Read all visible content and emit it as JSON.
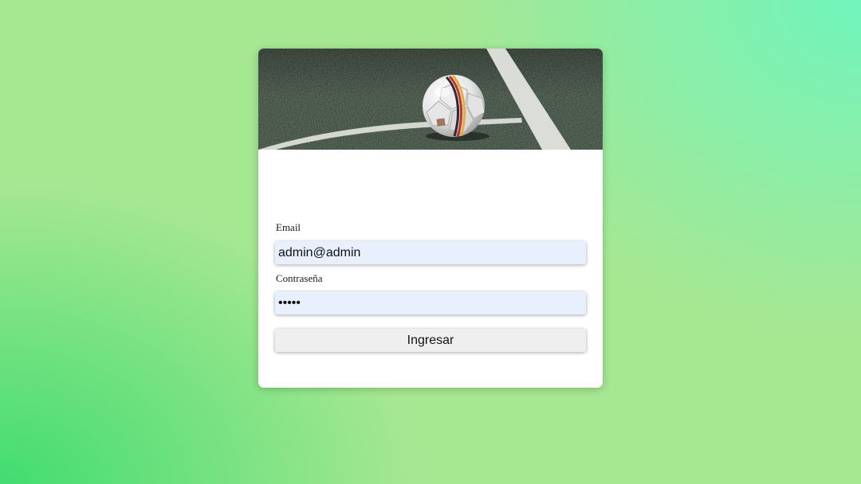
{
  "login": {
    "email_label": "Email",
    "email_value": "admin@admin",
    "password_label": "Contraseña",
    "password_value": "admin",
    "submit_label": "Ingresar"
  },
  "colors": {
    "input_bg": "#e8f0fe",
    "button_bg": "#efefef",
    "card_bg": "#ffffff"
  },
  "icons": {
    "hero": "soccer-ball-on-pitch-photo"
  }
}
